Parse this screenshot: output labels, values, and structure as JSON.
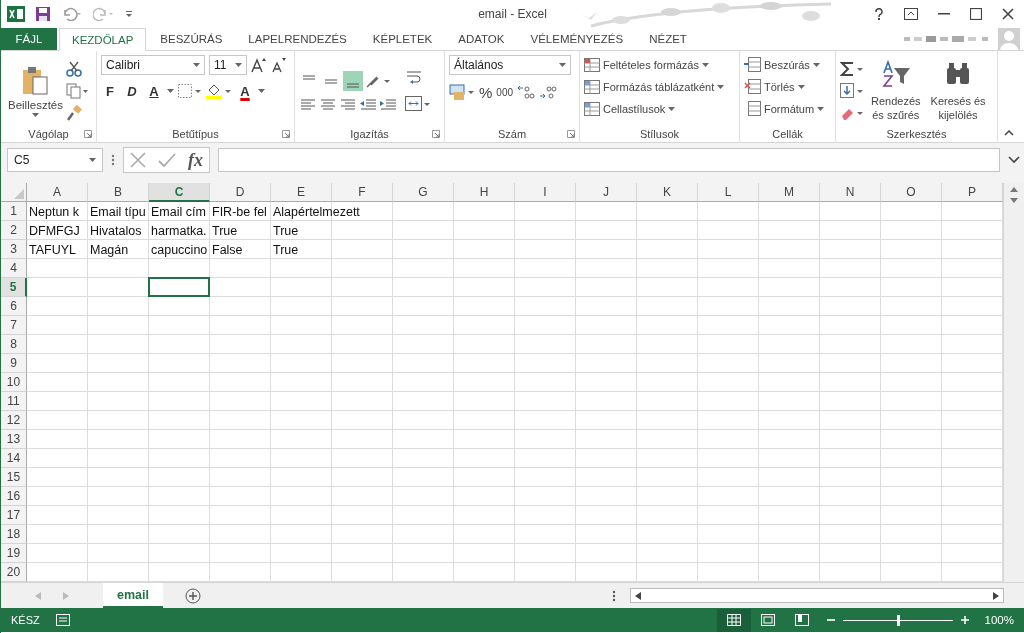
{
  "window": {
    "title": "email - Excel"
  },
  "tabs": [
    {
      "label": "FÁJL",
      "kind": "file",
      "selected": false
    },
    {
      "label": "KEZDŐLAP",
      "kind": "tab",
      "selected": true
    },
    {
      "label": "BESZÚRÁS",
      "kind": "tab",
      "selected": false
    },
    {
      "label": "LAPELRENDEZÉS",
      "kind": "tab",
      "selected": false
    },
    {
      "label": "KÉPLETEK",
      "kind": "tab",
      "selected": false
    },
    {
      "label": "ADATOK",
      "kind": "tab",
      "selected": false
    },
    {
      "label": "VÉLEMÉNYEZÉS",
      "kind": "tab",
      "selected": false
    },
    {
      "label": "NÉZET",
      "kind": "tab",
      "selected": false
    }
  ],
  "ribbon": {
    "clipboard": {
      "label": "Vágólap",
      "paste": "Beillesztés"
    },
    "font": {
      "label": "Betűtípus",
      "font_name": "Calibri",
      "font_size": "11",
      "bold": "F",
      "italic": "D",
      "underline": "A",
      "font_color": "A"
    },
    "alignment": {
      "label": "Igazítás",
      "vertical": [
        {
          "selected": false
        },
        {
          "selected": false
        },
        {
          "selected": true
        }
      ]
    },
    "number": {
      "label": "Szám",
      "format": "Általános",
      "percent": "%",
      "thousands": "000"
    },
    "styles": {
      "label": "Stílusok",
      "items": [
        "Feltételes formázás",
        "Formázás táblázatként",
        "Cellastílusok"
      ]
    },
    "cells": {
      "label": "Cellák",
      "items": [
        "Beszúrás",
        "Törlés",
        "Formátum"
      ]
    },
    "editing": {
      "label": "Szerkesztés",
      "sort": [
        "Rendezés",
        "és szűrés"
      ],
      "find": [
        "Keresés és",
        "kijelölés"
      ]
    }
  },
  "formula_bar": {
    "name_box": "C5",
    "fx": "fx"
  },
  "sheet": {
    "columns": [
      {
        "label": "A",
        "selected": false
      },
      {
        "label": "B",
        "selected": false
      },
      {
        "label": "C",
        "selected": true
      },
      {
        "label": "D",
        "selected": false
      },
      {
        "label": "E",
        "selected": false
      },
      {
        "label": "F",
        "selected": false
      },
      {
        "label": "G",
        "selected": false
      },
      {
        "label": "H",
        "selected": false
      },
      {
        "label": "I",
        "selected": false
      },
      {
        "label": "J",
        "selected": false
      },
      {
        "label": "K",
        "selected": false
      },
      {
        "label": "L",
        "selected": false
      },
      {
        "label": "M",
        "selected": false
      },
      {
        "label": "N",
        "selected": false
      },
      {
        "label": "O",
        "selected": false
      },
      {
        "label": "P",
        "selected": false
      }
    ],
    "rows": [
      {
        "number": "1",
        "selected": false,
        "cells": [
          "Neptun k",
          "Email típu",
          "Email cím",
          "FIR-be fel",
          "Alapértelmezett"
        ]
      },
      {
        "number": "2",
        "selected": false,
        "cells": [
          "DFMFGJ",
          "Hivatalos",
          "harmatka.",
          "True",
          "True"
        ]
      },
      {
        "number": "3",
        "selected": false,
        "cells": [
          "TAFUYL",
          "Magán",
          "capuccino",
          "False",
          "True"
        ]
      },
      {
        "number": "4",
        "selected": false
      },
      {
        "number": "5",
        "selected": true
      },
      {
        "number": "6",
        "selected": false
      },
      {
        "number": "7",
        "selected": false
      },
      {
        "number": "8",
        "selected": false
      },
      {
        "number": "9",
        "selected": false
      },
      {
        "number": "10",
        "selected": false
      },
      {
        "number": "11",
        "selected": false
      },
      {
        "number": "12",
        "selected": false
      },
      {
        "number": "13",
        "selected": false
      },
      {
        "number": "14",
        "selected": false
      },
      {
        "number": "15",
        "selected": false
      },
      {
        "number": "16",
        "selected": false
      },
      {
        "number": "17",
        "selected": false
      },
      {
        "number": "18",
        "selected": false
      },
      {
        "number": "19",
        "selected": false
      },
      {
        "number": "20",
        "selected": false
      }
    ]
  },
  "sheet_tabs": [
    {
      "label": "email",
      "selected": true
    }
  ],
  "status_bar": {
    "status": "KÉSZ",
    "zoom": "100%",
    "zoom_slider": {
      "level": 0.5
    }
  }
}
